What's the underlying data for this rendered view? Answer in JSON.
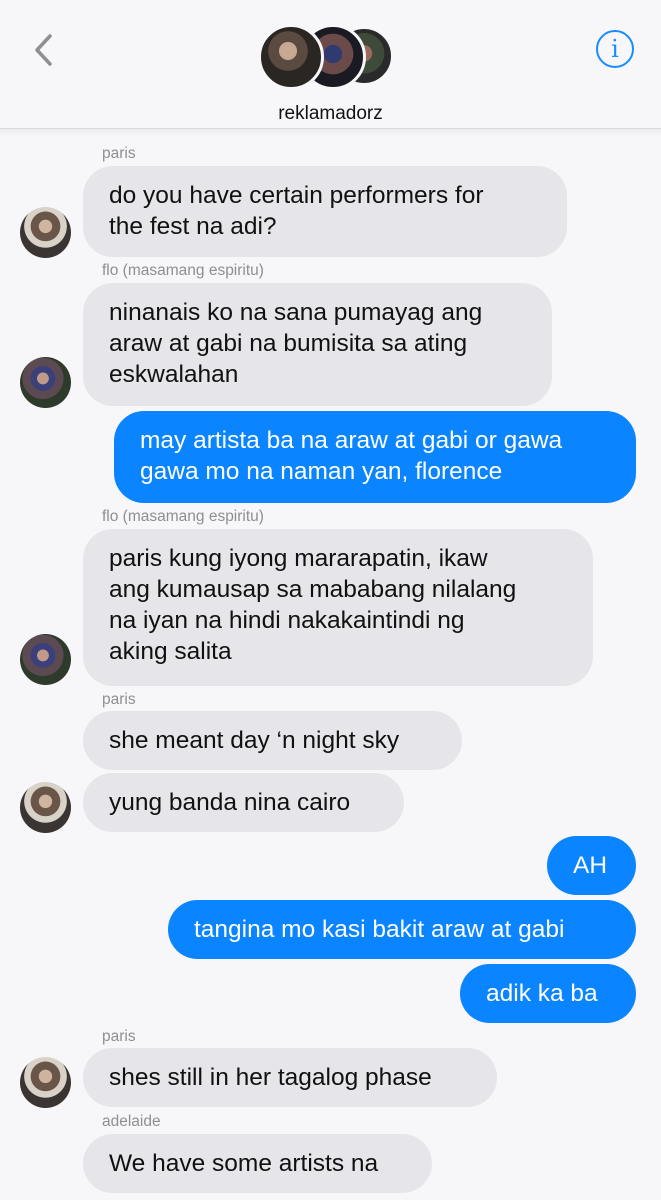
{
  "header": {
    "back_icon": "chevron-left-icon",
    "group_name": "reklamadorz",
    "info_glyph": "i",
    "info_icon": "info-icon",
    "accent": "#1a8cff"
  },
  "messages": [
    {
      "sender": "paris",
      "text1": "do you have certain performers for",
      "text2": "the fest na adi?"
    },
    {
      "sender": "flo (masamang espiritu)",
      "text1": "ninanais ko na sana pumayag ang",
      "text2": "araw at gabi na bumisita sa ating",
      "text3": "eskwalahan"
    },
    {
      "text1": "may artista ba na araw at gabi or gawa",
      "text2": "gawa mo na naman yan, florence"
    },
    {
      "sender": "flo (masamang espiritu)",
      "text1": "paris kung iyong mararapatin, ikaw",
      "text2": "ang kumausap sa mababang nilalang",
      "text3": "na iyan na hindi nakakaintindi ng",
      "text4": "aking salita"
    },
    {
      "sender": "paris",
      "text1": "she meant day ‘n night sky"
    },
    {
      "text1": "yung banda nina cairo"
    },
    {
      "text1": "AH"
    },
    {
      "text1": "tangina mo kasi bakit araw at gabi"
    },
    {
      "text1": "adik ka ba"
    },
    {
      "sender": "paris",
      "text1": "shes still in her tagalog phase"
    },
    {
      "sender": "adelaide",
      "text1": "We have some artists na"
    }
  ],
  "colors": {
    "incoming_bubble": "#e5e5ea",
    "outgoing_bubble": "#0a84ff",
    "background": "#f7f7fa"
  }
}
